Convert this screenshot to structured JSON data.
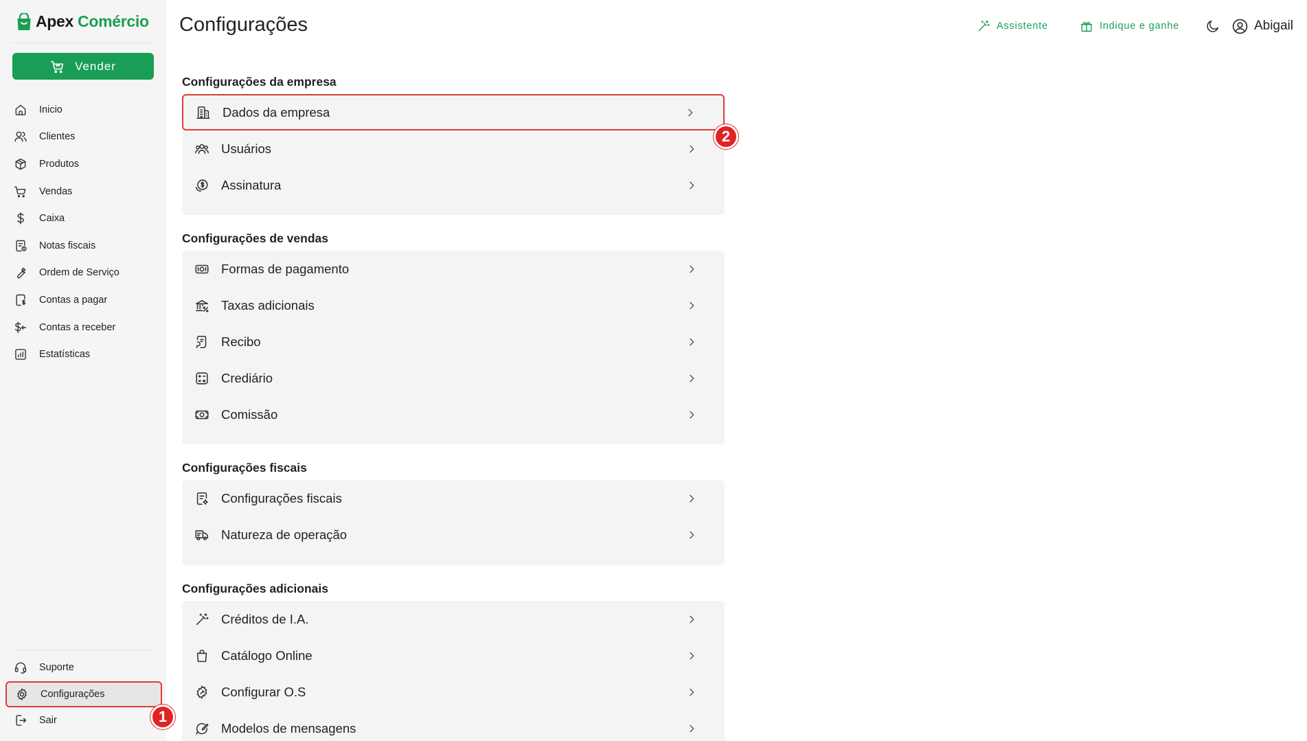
{
  "brand": {
    "part1": "Apex",
    "part2": "Comércio"
  },
  "sidebar": {
    "sell_label": "Vender",
    "items": [
      {
        "label": "Inicio",
        "icon": "home-icon"
      },
      {
        "label": "Clientes",
        "icon": "users-icon"
      },
      {
        "label": "Produtos",
        "icon": "box-icon"
      },
      {
        "label": "Vendas",
        "icon": "cart-icon"
      },
      {
        "label": "Caixa",
        "icon": "dollar-icon"
      },
      {
        "label": "Notas fiscais",
        "icon": "receipt-icon"
      },
      {
        "label": "Ordem de Serviço",
        "icon": "wrench-icon"
      },
      {
        "label": "Contas a pagar",
        "icon": "bill-icon"
      },
      {
        "label": "Contas a receber",
        "icon": "receivable-icon"
      },
      {
        "label": "Estatísticas",
        "icon": "chart-icon"
      }
    ],
    "bottom": [
      {
        "label": "Suporte",
        "icon": "headset-icon"
      },
      {
        "label": "Configurações",
        "icon": "gear-icon",
        "active": true
      },
      {
        "label": "Sair",
        "icon": "logout-icon"
      }
    ]
  },
  "header": {
    "title": "Configurações",
    "assistant": "Assistente",
    "refer": "Indique e ganhe",
    "user": "Abigail"
  },
  "annotations": {
    "badge1": "1",
    "badge2": "2"
  },
  "sections": [
    {
      "title": "Configurações da empresa",
      "items": [
        "Dados da empresa",
        "Usuários",
        "Assinatura"
      ]
    },
    {
      "title": "Configurações de vendas",
      "items": [
        "Formas de pagamento",
        "Taxas adicionais",
        "Recibo",
        "Crediário",
        "Comissão"
      ]
    },
    {
      "title": "Configurações fiscais",
      "items": [
        "Configurações fiscais",
        "Natureza de operação"
      ]
    },
    {
      "title": "Configurações adicionais",
      "items": [
        "Créditos de I.A.",
        "Catálogo Online",
        "Configurar O.S",
        "Modelos de mensagens"
      ]
    }
  ],
  "colors": {
    "accent": "#1a9e55",
    "highlight": "#e53935",
    "badge": "#e02424"
  }
}
